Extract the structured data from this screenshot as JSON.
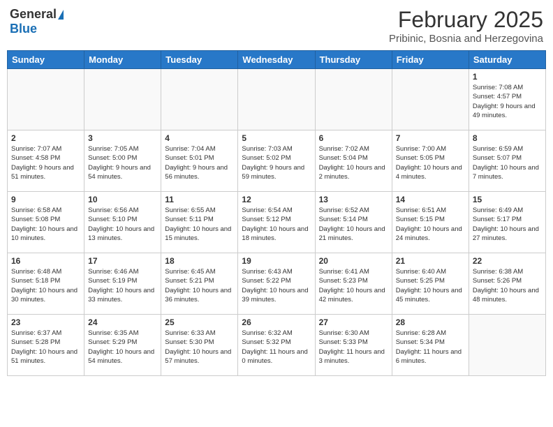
{
  "header": {
    "logo_general": "General",
    "logo_blue": "Blue",
    "month_title": "February 2025",
    "subtitle": "Pribinic, Bosnia and Herzegovina"
  },
  "days_of_week": [
    "Sunday",
    "Monday",
    "Tuesday",
    "Wednesday",
    "Thursday",
    "Friday",
    "Saturday"
  ],
  "weeks": [
    [
      {
        "day": "",
        "info": ""
      },
      {
        "day": "",
        "info": ""
      },
      {
        "day": "",
        "info": ""
      },
      {
        "day": "",
        "info": ""
      },
      {
        "day": "",
        "info": ""
      },
      {
        "day": "",
        "info": ""
      },
      {
        "day": "1",
        "info": "Sunrise: 7:08 AM\nSunset: 4:57 PM\nDaylight: 9 hours and 49 minutes."
      }
    ],
    [
      {
        "day": "2",
        "info": "Sunrise: 7:07 AM\nSunset: 4:58 PM\nDaylight: 9 hours and 51 minutes."
      },
      {
        "day": "3",
        "info": "Sunrise: 7:05 AM\nSunset: 5:00 PM\nDaylight: 9 hours and 54 minutes."
      },
      {
        "day": "4",
        "info": "Sunrise: 7:04 AM\nSunset: 5:01 PM\nDaylight: 9 hours and 56 minutes."
      },
      {
        "day": "5",
        "info": "Sunrise: 7:03 AM\nSunset: 5:02 PM\nDaylight: 9 hours and 59 minutes."
      },
      {
        "day": "6",
        "info": "Sunrise: 7:02 AM\nSunset: 5:04 PM\nDaylight: 10 hours and 2 minutes."
      },
      {
        "day": "7",
        "info": "Sunrise: 7:00 AM\nSunset: 5:05 PM\nDaylight: 10 hours and 4 minutes."
      },
      {
        "day": "8",
        "info": "Sunrise: 6:59 AM\nSunset: 5:07 PM\nDaylight: 10 hours and 7 minutes."
      }
    ],
    [
      {
        "day": "9",
        "info": "Sunrise: 6:58 AM\nSunset: 5:08 PM\nDaylight: 10 hours and 10 minutes."
      },
      {
        "day": "10",
        "info": "Sunrise: 6:56 AM\nSunset: 5:10 PM\nDaylight: 10 hours and 13 minutes."
      },
      {
        "day": "11",
        "info": "Sunrise: 6:55 AM\nSunset: 5:11 PM\nDaylight: 10 hours and 15 minutes."
      },
      {
        "day": "12",
        "info": "Sunrise: 6:54 AM\nSunset: 5:12 PM\nDaylight: 10 hours and 18 minutes."
      },
      {
        "day": "13",
        "info": "Sunrise: 6:52 AM\nSunset: 5:14 PM\nDaylight: 10 hours and 21 minutes."
      },
      {
        "day": "14",
        "info": "Sunrise: 6:51 AM\nSunset: 5:15 PM\nDaylight: 10 hours and 24 minutes."
      },
      {
        "day": "15",
        "info": "Sunrise: 6:49 AM\nSunset: 5:17 PM\nDaylight: 10 hours and 27 minutes."
      }
    ],
    [
      {
        "day": "16",
        "info": "Sunrise: 6:48 AM\nSunset: 5:18 PM\nDaylight: 10 hours and 30 minutes."
      },
      {
        "day": "17",
        "info": "Sunrise: 6:46 AM\nSunset: 5:19 PM\nDaylight: 10 hours and 33 minutes."
      },
      {
        "day": "18",
        "info": "Sunrise: 6:45 AM\nSunset: 5:21 PM\nDaylight: 10 hours and 36 minutes."
      },
      {
        "day": "19",
        "info": "Sunrise: 6:43 AM\nSunset: 5:22 PM\nDaylight: 10 hours and 39 minutes."
      },
      {
        "day": "20",
        "info": "Sunrise: 6:41 AM\nSunset: 5:23 PM\nDaylight: 10 hours and 42 minutes."
      },
      {
        "day": "21",
        "info": "Sunrise: 6:40 AM\nSunset: 5:25 PM\nDaylight: 10 hours and 45 minutes."
      },
      {
        "day": "22",
        "info": "Sunrise: 6:38 AM\nSunset: 5:26 PM\nDaylight: 10 hours and 48 minutes."
      }
    ],
    [
      {
        "day": "23",
        "info": "Sunrise: 6:37 AM\nSunset: 5:28 PM\nDaylight: 10 hours and 51 minutes."
      },
      {
        "day": "24",
        "info": "Sunrise: 6:35 AM\nSunset: 5:29 PM\nDaylight: 10 hours and 54 minutes."
      },
      {
        "day": "25",
        "info": "Sunrise: 6:33 AM\nSunset: 5:30 PM\nDaylight: 10 hours and 57 minutes."
      },
      {
        "day": "26",
        "info": "Sunrise: 6:32 AM\nSunset: 5:32 PM\nDaylight: 11 hours and 0 minutes."
      },
      {
        "day": "27",
        "info": "Sunrise: 6:30 AM\nSunset: 5:33 PM\nDaylight: 11 hours and 3 minutes."
      },
      {
        "day": "28",
        "info": "Sunrise: 6:28 AM\nSunset: 5:34 PM\nDaylight: 11 hours and 6 minutes."
      },
      {
        "day": "",
        "info": ""
      }
    ]
  ]
}
